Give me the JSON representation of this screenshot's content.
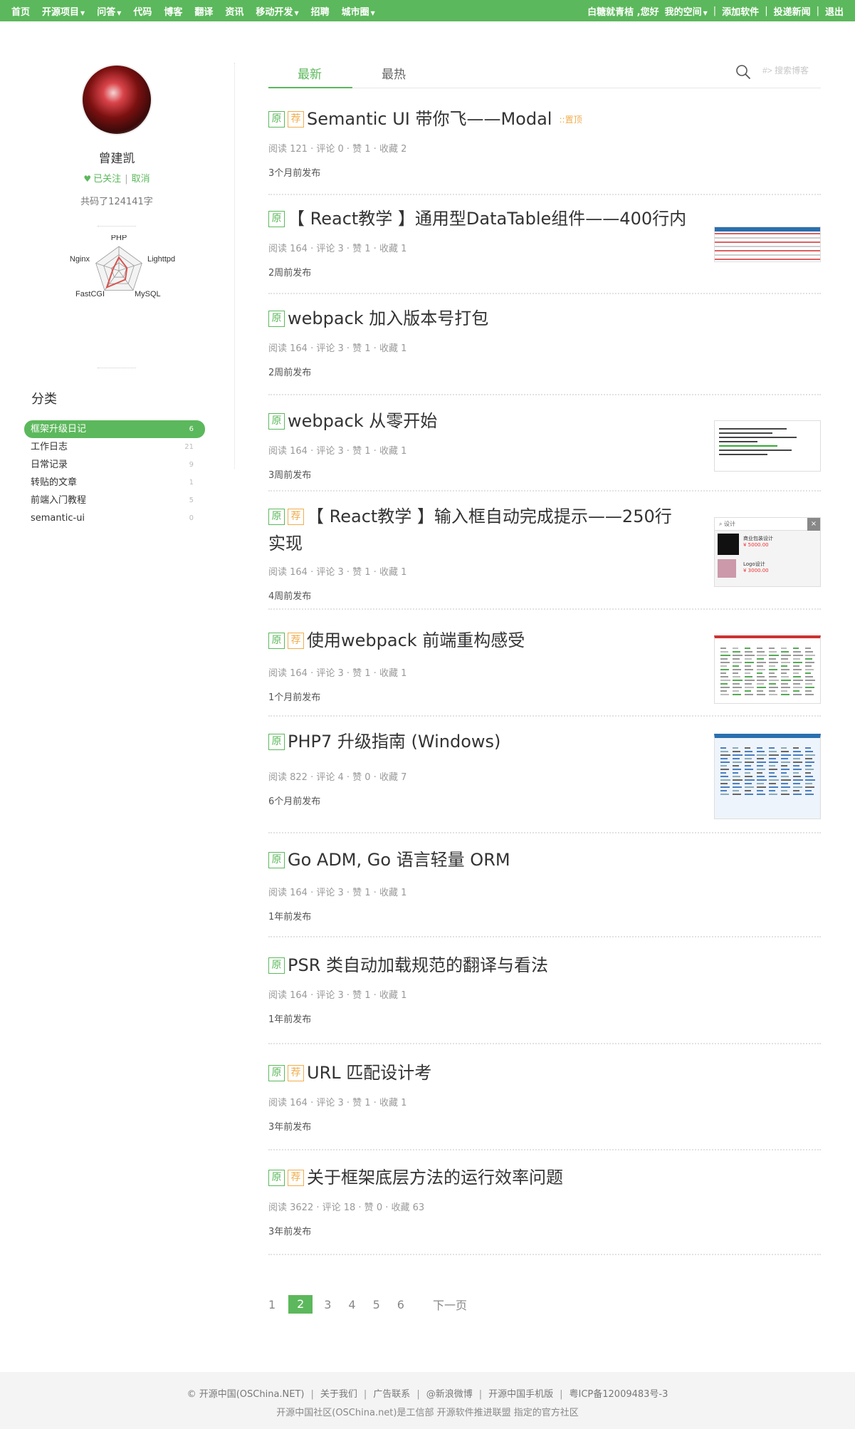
{
  "nav": {
    "left": [
      {
        "label": "首页",
        "caret": false
      },
      {
        "label": "开源项目",
        "caret": true
      },
      {
        "label": "问答",
        "caret": true
      },
      {
        "label": "代码",
        "caret": false
      },
      {
        "label": "博客",
        "caret": false
      },
      {
        "label": "翻译",
        "caret": false
      },
      {
        "label": "资讯",
        "caret": false
      },
      {
        "label": "移动开发",
        "caret": true
      },
      {
        "label": "招聘",
        "caret": false
      },
      {
        "label": "城市圈",
        "caret": true
      }
    ],
    "greeting": "白糖就青桔 ,您好",
    "my_space": "我的空间",
    "add_software": "添加软件",
    "submit_news": "投递新闻",
    "logout": "退出",
    "separator": "|"
  },
  "profile": {
    "name": "曾建凯",
    "followed": "已关注",
    "unfollow": "取消",
    "follow_separator": "|",
    "word_count": "共码了124141字",
    "skills": [
      "PHP",
      "Lighttpd",
      "MySQL",
      "FastCGI",
      "Nginx"
    ],
    "skill_levels": [
      0.55,
      0.35,
      0.45,
      0.85,
      0.25
    ]
  },
  "categories": {
    "title": "分类",
    "items": [
      {
        "label": "框架升级日记",
        "count": "6",
        "active": true
      },
      {
        "label": "工作日志",
        "count": "21",
        "active": false
      },
      {
        "label": "日常记录",
        "count": "9",
        "active": false
      },
      {
        "label": "转贴的文章",
        "count": "1",
        "active": false
      },
      {
        "label": "前端入门教程",
        "count": "5",
        "active": false
      },
      {
        "label": "semantic-ui",
        "count": "0",
        "active": false
      }
    ]
  },
  "tabs": {
    "latest": "最新",
    "hot": "最热"
  },
  "search": {
    "placeholder": "#> 搜索博客"
  },
  "badges": {
    "original": "原",
    "recommended": "荐"
  },
  "articles": [
    {
      "title": "Semantic UI 带你飞——Modal",
      "recommended": true,
      "pinned": "::置顶",
      "meta": "阅读 121 · 评论 0 · 赞 1 · 收藏 2",
      "ago": "3个月前发布"
    },
    {
      "title": "【 React教学 】通用型DataTable组件——400行内",
      "recommended": false,
      "meta": "阅读 164 · 评论 3 · 赞 1 · 收藏 1",
      "ago": "2周前发布"
    },
    {
      "title": "webpack 加入版本号打包",
      "recommended": false,
      "meta": "阅读 164 · 评论 3 · 赞 1 · 收藏 1",
      "ago": "2周前发布"
    },
    {
      "title": "webpack 从零开始",
      "recommended": false,
      "meta": "阅读 164 · 评论 3 · 赞 1 · 收藏 1",
      "ago": "3周前发布"
    },
    {
      "title": "【 React教学 】输入框自动完成提示——250行实现",
      "recommended": true,
      "meta": "阅读 164 · 评论 3 · 赞 1 · 收藏 1",
      "ago": "4周前发布"
    },
    {
      "title": "使用webpack 前端重构感受",
      "recommended": true,
      "meta": "阅读 164 · 评论 3 · 赞 1 · 收藏 1",
      "ago": "1个月前发布"
    },
    {
      "title": "PHP7  升级指南 (Windows)",
      "recommended": false,
      "meta": "阅读 822 · 评论 4 · 赞 0 · 收藏 7",
      "ago": "6个月前发布"
    },
    {
      "title": "Go ADM, Go 语言轻量 ORM",
      "recommended": false,
      "meta": "阅读 164 · 评论 3 · 赞 1 · 收藏 1",
      "ago": "1年前发布"
    },
    {
      "title": "PSR 类自动加载规范的翻译与看法",
      "recommended": false,
      "meta": "阅读 164 · 评论 3 · 赞 1 · 收藏 1",
      "ago": "1年前发布"
    },
    {
      "title": "URL 匹配设计考",
      "recommended": true,
      "meta": "阅读 164 · 评论 3 · 赞 1 · 收藏 1",
      "ago": "3年前发布"
    },
    {
      "title": "关于框架底层方法的运行效率问题",
      "recommended": true,
      "meta": "阅读 3622 · 评论 18 · 赞 0 · 收藏 63",
      "ago": "3年前发布"
    }
  ],
  "thumb_text": {
    "search_label": "设计",
    "item1_title": "商业包装设计",
    "item1_price": "¥ 5000.00",
    "item2_title": "Logo设计",
    "item2_price": "¥ 3000.00",
    "close": "×"
  },
  "pagination": {
    "pages": [
      "1",
      "2",
      "3",
      "4",
      "5",
      "6"
    ],
    "current": "2",
    "next": "下一页"
  },
  "footer": {
    "links": [
      "© 开源中国(OSChina.NET)",
      "关于我们",
      "广告联系",
      "@新浪微博",
      "开源中国手机版",
      "粤ICP备12009483号-3"
    ],
    "separator": "|",
    "line2": "开源中国社区(OSChina.net)是工信部 开源软件推进联盟 指定的官方社区"
  },
  "colors": {
    "brand_green": "#5cb85c",
    "recommend_orange": "#f0ad4e"
  }
}
